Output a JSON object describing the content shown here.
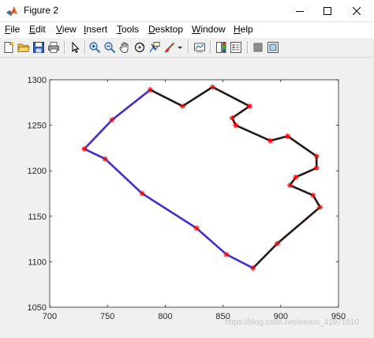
{
  "window": {
    "title": "Figure 2",
    "minimize_icon": "minimize-icon",
    "maximize_icon": "maximize-icon",
    "close_icon": "close-icon"
  },
  "menu": [
    {
      "label": "File",
      "mnemonic": "F",
      "rest": "ile"
    },
    {
      "label": "Edit",
      "mnemonic": "E",
      "rest": "dit"
    },
    {
      "label": "View",
      "mnemonic": "V",
      "rest": "iew"
    },
    {
      "label": "Insert",
      "mnemonic": "I",
      "rest": "nsert"
    },
    {
      "label": "Tools",
      "mnemonic": "T",
      "rest": "ools"
    },
    {
      "label": "Desktop",
      "mnemonic": "D",
      "rest": "esktop"
    },
    {
      "label": "Window",
      "mnemonic": "W",
      "rest": "indow"
    },
    {
      "label": "Help",
      "mnemonic": "H",
      "rest": "elp"
    }
  ],
  "toolbar": [
    "new-figure-icon",
    "open-file-icon",
    "save-icon",
    "print-icon",
    "pointer-icon",
    "zoom-in-icon",
    "zoom-out-icon",
    "pan-icon",
    "rotate-3d-icon",
    "data-cursor-icon",
    "brush-icon",
    "brush-dropdown-icon",
    "link-plot-icon",
    "colorbar-icon",
    "legend-icon",
    "hide-plot-tools-icon",
    "show-plot-tools-icon"
  ],
  "watermark": "https://blog.csdn.net/weixin_41971010",
  "colors": {
    "marker": "#ff0000",
    "series_black": "#000000",
    "series_blue": "#1f1fcf",
    "series_purple": "#6a1fa8",
    "axis": "#262626"
  },
  "chart_data": {
    "type": "line",
    "title": "",
    "xlabel": "",
    "ylabel": "",
    "xlim": [
      700,
      950
    ],
    "ylim": [
      1050,
      1300
    ],
    "xticks": [
      700,
      750,
      800,
      850,
      900,
      950
    ],
    "yticks": [
      1050,
      1100,
      1150,
      1200,
      1250,
      1300
    ],
    "grid": false,
    "legend": "none",
    "markers": {
      "style": "asterisk",
      "points": [
        [
          787,
          1289
        ],
        [
          815,
          1271
        ],
        [
          841,
          1292
        ],
        [
          873,
          1271
        ],
        [
          858,
          1258
        ],
        [
          861,
          1250
        ],
        [
          891,
          1233
        ],
        [
          906,
          1238
        ],
        [
          931,
          1216
        ],
        [
          931,
          1203
        ],
        [
          913,
          1193
        ],
        [
          908,
          1184
        ],
        [
          928,
          1173
        ],
        [
          934,
          1160
        ],
        [
          876,
          1093
        ],
        [
          853,
          1108
        ],
        [
          827,
          1137
        ],
        [
          780,
          1175
        ],
        [
          748,
          1213
        ],
        [
          730,
          1224
        ],
        [
          754,
          1256
        ],
        [
          897,
          1120
        ]
      ]
    },
    "series": [
      {
        "color": "#000000",
        "points": [
          [
            787,
            1289
          ],
          [
            815,
            1271
          ],
          [
            841,
            1292
          ],
          [
            873,
            1271
          ],
          [
            858,
            1258
          ],
          [
            861,
            1250
          ],
          [
            891,
            1233
          ],
          [
            906,
            1238
          ],
          [
            931,
            1216
          ],
          [
            931,
            1203
          ],
          [
            913,
            1193
          ],
          [
            908,
            1184
          ],
          [
            928,
            1173
          ],
          [
            934,
            1160
          ],
          [
            897,
            1120
          ],
          [
            876,
            1093
          ]
        ]
      },
      {
        "color": "#1f1fcf",
        "points": [
          [
            876,
            1093
          ],
          [
            853,
            1108
          ],
          [
            827,
            1137
          ],
          [
            780,
            1175
          ],
          [
            748,
            1213
          ],
          [
            730,
            1224
          ],
          [
            754,
            1256
          ],
          [
            787,
            1289
          ]
        ]
      }
    ]
  }
}
